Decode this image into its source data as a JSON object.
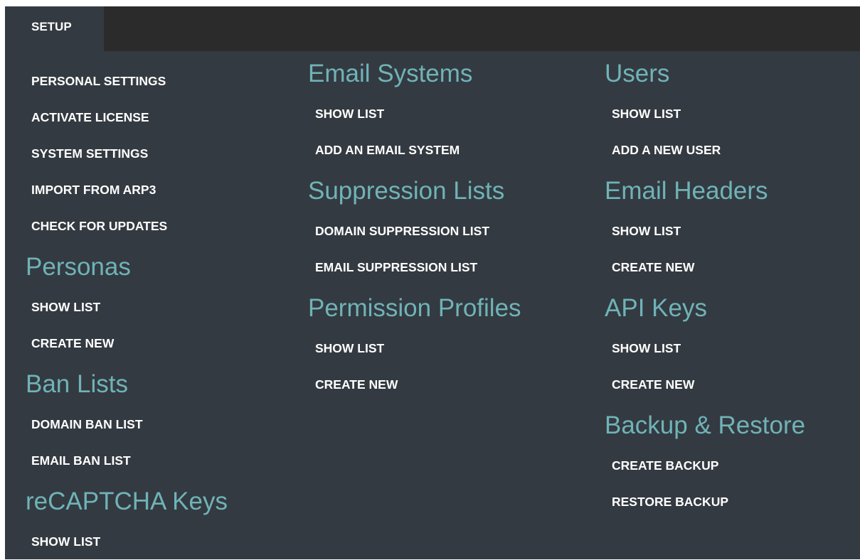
{
  "topbar": {
    "tab_label": "SETUP"
  },
  "colors": {
    "panel": "#343a41",
    "topbar": "#2b2b2b",
    "heading": "#6fb3b8",
    "link": "#ffffff"
  },
  "col1": {
    "general": [
      "PERSONAL SETTINGS",
      "ACTIVATE LICENSE",
      "SYSTEM SETTINGS",
      "IMPORT FROM ARP3",
      "CHECK FOR UPDATES"
    ],
    "personas": {
      "title": "Personas",
      "links": [
        "SHOW LIST",
        "CREATE NEW"
      ]
    },
    "ban_lists": {
      "title": "Ban Lists",
      "links": [
        "DOMAIN BAN LIST",
        "EMAIL BAN LIST"
      ]
    },
    "recaptcha": {
      "title": "reCAPTCHA Keys",
      "links": [
        "SHOW LIST"
      ]
    }
  },
  "col2": {
    "email_systems": {
      "title": "Email Systems",
      "links": [
        "SHOW LIST",
        "ADD AN EMAIL SYSTEM"
      ]
    },
    "suppression": {
      "title": "Suppression Lists",
      "links": [
        "DOMAIN SUPPRESSION LIST",
        "EMAIL SUPPRESSION LIST"
      ]
    },
    "permission": {
      "title": "Permission Profiles",
      "links": [
        "SHOW LIST",
        "CREATE NEW"
      ]
    }
  },
  "col3": {
    "users": {
      "title": "Users",
      "links": [
        "SHOW LIST",
        "ADD A NEW USER"
      ]
    },
    "email_headers": {
      "title": "Email Headers",
      "links": [
        "SHOW LIST",
        "CREATE NEW"
      ]
    },
    "api_keys": {
      "title": "API Keys",
      "links": [
        "SHOW LIST",
        "CREATE NEW"
      ]
    },
    "backup": {
      "title": "Backup & Restore",
      "links": [
        "CREATE BACKUP",
        "RESTORE BACKUP"
      ]
    }
  }
}
